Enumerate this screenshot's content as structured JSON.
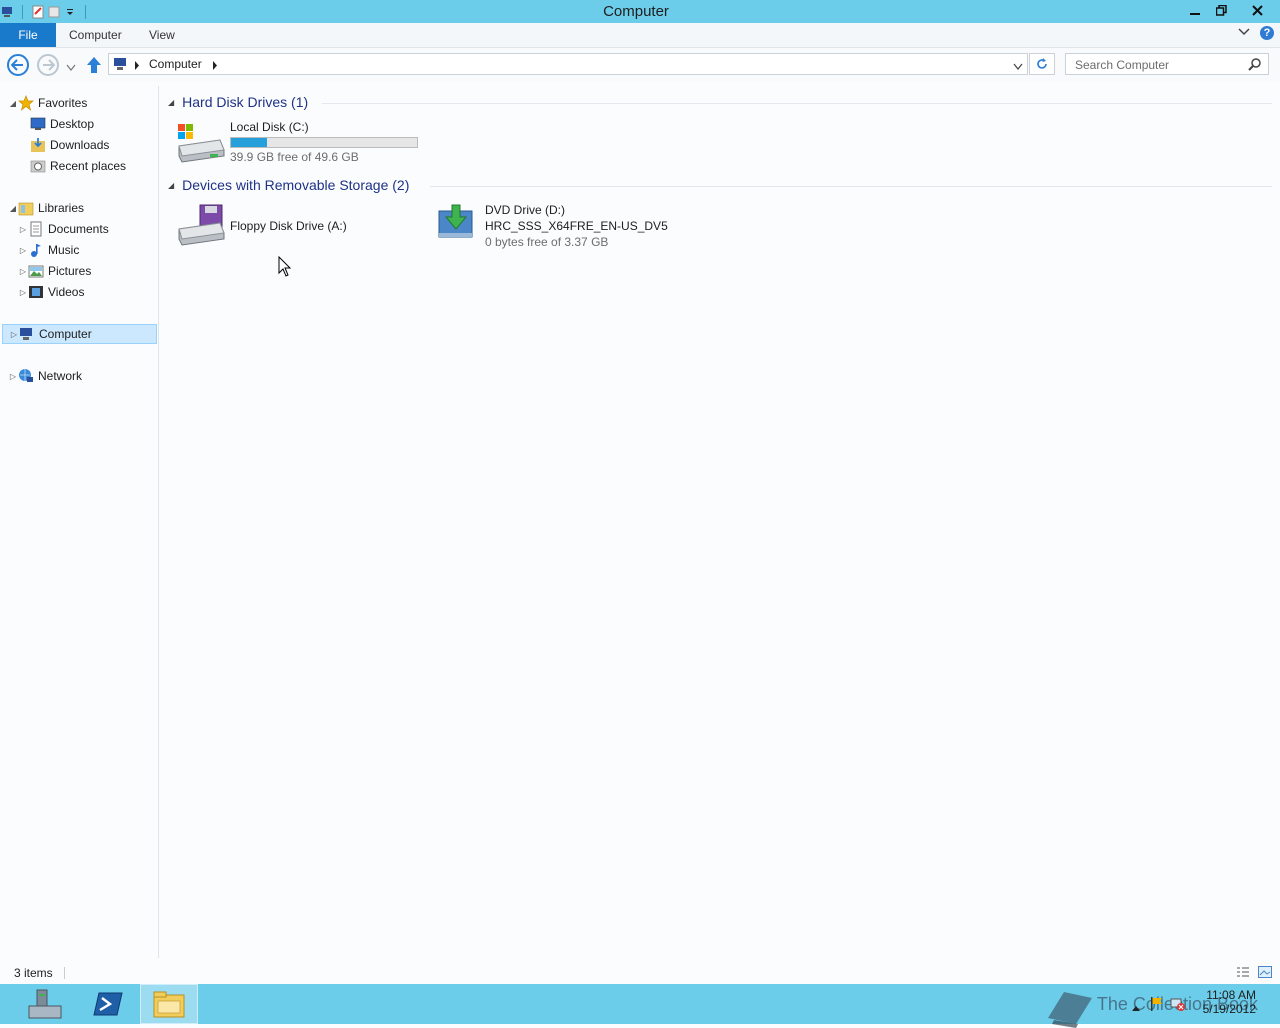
{
  "window": {
    "title": "Computer"
  },
  "ribbon": {
    "tabs": [
      {
        "label": "File"
      },
      {
        "label": "Computer"
      },
      {
        "label": "View"
      }
    ]
  },
  "address": {
    "segments": [
      "Computer"
    ]
  },
  "search": {
    "placeholder": "Search Computer"
  },
  "navpane": {
    "favorites": {
      "label": "Favorites",
      "items": [
        "Desktop",
        "Downloads",
        "Recent places"
      ]
    },
    "libraries": {
      "label": "Libraries",
      "items": [
        "Documents",
        "Music",
        "Pictures",
        "Videos"
      ]
    },
    "computer": {
      "label": "Computer"
    },
    "network": {
      "label": "Network"
    }
  },
  "groups": [
    {
      "header": "Hard Disk Drives (1)",
      "drives": [
        {
          "name": "Local Disk (C:)",
          "free_text": "39.9 GB free of 49.6 GB",
          "used_fraction": 0.196
        }
      ]
    },
    {
      "header": "Devices with Removable Storage (2)",
      "drives": [
        {
          "name": "Floppy Disk Drive (A:)"
        },
        {
          "name": "DVD Drive (D:)",
          "label": "HRC_SSS_X64FRE_EN-US_DV5",
          "free_text": "0 bytes free of 3.37 GB"
        }
      ]
    }
  ],
  "status": {
    "item_count": "3 items"
  },
  "taskbar": {
    "time": "11:08 AM",
    "date": "5/19/2012",
    "watermark": "The Collection Book"
  },
  "colors": {
    "accent": "#6ccdea",
    "file_tab": "#1979ca",
    "header_text": "#1e3287",
    "usage_bar": "#26a0da"
  }
}
